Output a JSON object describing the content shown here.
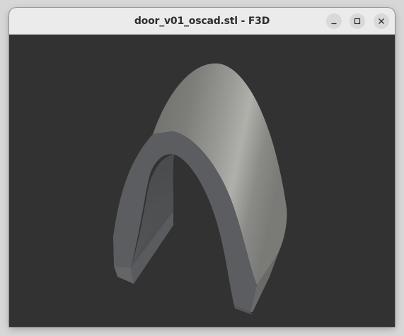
{
  "window": {
    "title": "door_v01_oscad.stl - F3D"
  },
  "controls": {
    "minimize": "minimize",
    "maximize": "maximize",
    "close": "close"
  },
  "viewport": {
    "background": "#323232",
    "model_color": "#8c8c8a"
  }
}
